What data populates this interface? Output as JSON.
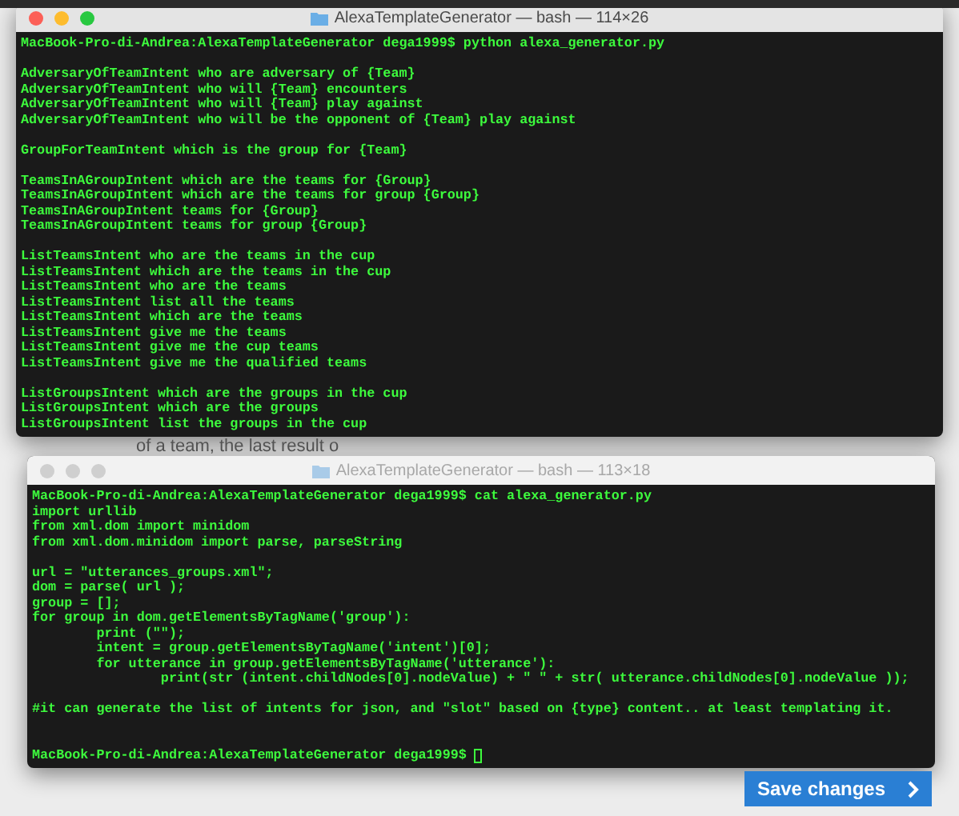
{
  "page": {
    "behind_text": "of a team, the last result o",
    "save_button": "Save changes"
  },
  "windows": [
    {
      "title": "AlexaTemplateGenerator — bash — 114×26",
      "active": true,
      "cursor": false,
      "blocks": [
        [
          "MacBook-Pro-di-Andrea:AlexaTemplateGenerator dega1999$ python alexa_generator.py"
        ],
        [
          "AdversaryOfTeamIntent who are adversary of {Team}",
          "AdversaryOfTeamIntent who will {Team} encounters",
          "AdversaryOfTeamIntent who will {Team} play against",
          "AdversaryOfTeamIntent who will be the opponent of {Team} play against"
        ],
        [
          "GroupForTeamIntent which is the group for {Team}"
        ],
        [
          "TeamsInAGroupIntent which are the teams for {Group}",
          "TeamsInAGroupIntent which are the teams for group {Group}",
          "TeamsInAGroupIntent teams for {Group}",
          "TeamsInAGroupIntent teams for group {Group}"
        ],
        [
          "ListTeamsIntent who are the teams in the cup",
          "ListTeamsIntent which are the teams in the cup",
          "ListTeamsIntent who are the teams",
          "ListTeamsIntent list all the teams",
          "ListTeamsIntent which are the teams",
          "ListTeamsIntent give me the teams",
          "ListTeamsIntent give me the cup teams",
          "ListTeamsIntent give me the qualified teams"
        ],
        [
          "ListGroupsIntent which are the groups in the cup",
          "ListGroupsIntent which are the groups",
          "ListGroupsIntent list the groups in the cup"
        ]
      ]
    },
    {
      "title": "AlexaTemplateGenerator — bash — 113×18",
      "active": false,
      "cursor": true,
      "blocks": [
        [
          "MacBook-Pro-di-Andrea:AlexaTemplateGenerator dega1999$ cat alexa_generator.py",
          "import urllib",
          "from xml.dom import minidom",
          "from xml.dom.minidom import parse, parseString"
        ],
        [
          "url = \"utterances_groups.xml\";",
          "dom = parse( url );",
          "group = [];",
          "for group in dom.getElementsByTagName('group'):",
          "        print (\"\");",
          "        intent = group.getElementsByTagName('intent')[0];",
          "        for utterance in group.getElementsByTagName('utterance'):",
          "                print(str (intent.childNodes[0].nodeValue) + \" \" + str( utterance.childNodes[0].nodeValue ));"
        ],
        [
          "#it can generate the list of intents for json, and \"slot\" based on {type} content.. at least templating it."
        ]
      ],
      "prompt_line": "MacBook-Pro-di-Andrea:AlexaTemplateGenerator dega1999$"
    }
  ]
}
